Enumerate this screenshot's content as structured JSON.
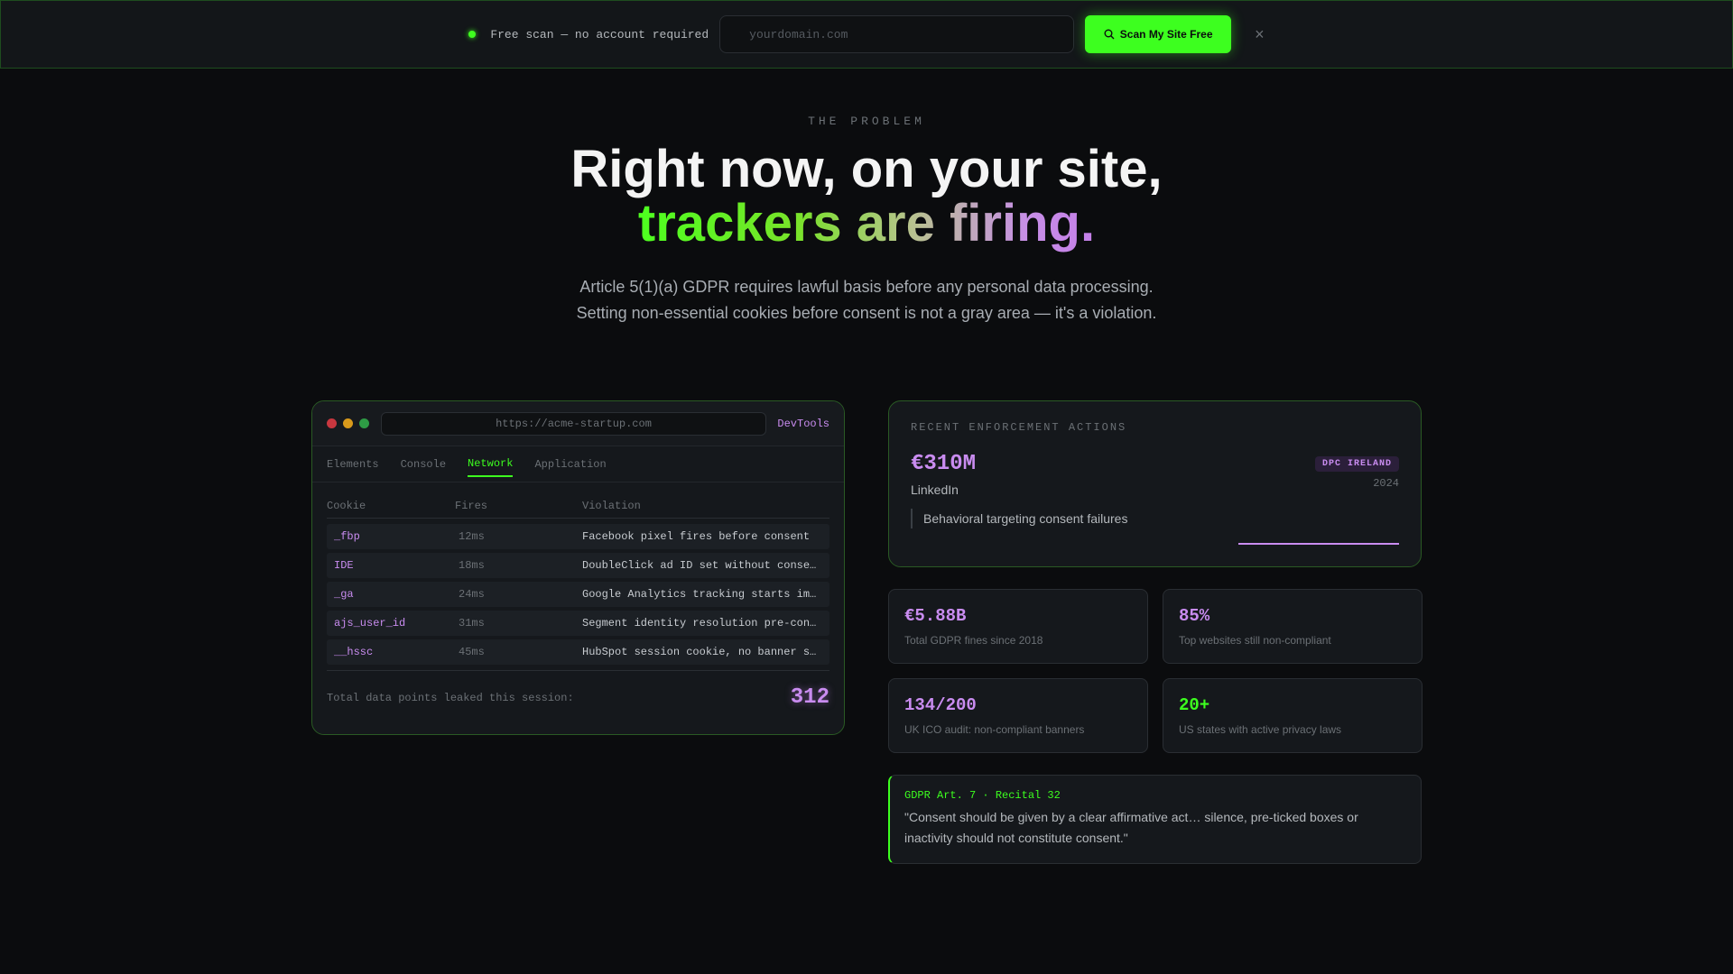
{
  "topbar": {
    "status_text": "Free scan — no account required",
    "input_placeholder": "yourdomain.com",
    "scan_button_label": "Scan My Site Free",
    "close_glyph": "×",
    "accent_color": "#3dff1f"
  },
  "hero": {
    "eyebrow": "THE PROBLEM",
    "title_line1": "Right now, on your site,",
    "title_line2": "trackers are firing.",
    "subtitle_line1": "Article 5(1)(a) GDPR requires lawful basis before any personal data processing.",
    "subtitle_line2": "Setting non-essential cookies before consent is not a gray area — it's a violation."
  },
  "devtools": {
    "url": "https://acme-startup.com",
    "label": "DevTools",
    "tabs": [
      "Elements",
      "Console",
      "Network",
      "Application"
    ],
    "active_tab": "Network",
    "columns": [
      "Cookie",
      "Fires",
      "Violation"
    ],
    "rows": [
      {
        "cookie": "_fbp",
        "fires": "12ms",
        "violation": "Facebook pixel fires before consent"
      },
      {
        "cookie": "IDE",
        "fires": "18ms",
        "violation": "DoubleClick ad ID set without consent"
      },
      {
        "cookie": "_ga",
        "fires": "24ms",
        "violation": "Google Analytics tracking starts immediately"
      },
      {
        "cookie": "ajs_user_id",
        "fires": "31ms",
        "violation": "Segment identity resolution pre-consent"
      },
      {
        "cookie": "__hssc",
        "fires": "45ms",
        "violation": "HubSpot session cookie, no banner shown"
      }
    ],
    "footer_label": "Total data points leaked this session:",
    "footer_count": "312",
    "traffic_light_colors": [
      "#c8373f",
      "#d99a1b",
      "#2e9b45"
    ]
  },
  "enforcement": {
    "eyebrow": "RECENT ENFORCEMENT ACTIONS",
    "amount": "€310M",
    "company": "LinkedIn",
    "badge": "DPC IRELAND",
    "year": "2024",
    "reason": "Behavioral targeting consent failures"
  },
  "stats": [
    {
      "value": "€5.88B",
      "label": "Total GDPR fines since 2018"
    },
    {
      "value": "85%",
      "label": "Top websites still non-compliant"
    },
    {
      "value": "134/200",
      "label": "UK ICO audit: non-compliant banners"
    },
    {
      "value": "20+",
      "label": "US states with active privacy laws"
    }
  ],
  "quote": {
    "reference": "GDPR Art. 7 · Recital 32",
    "text": "\"Consent should be given by a clear affirmative act… silence, pre-ticked boxes or inactivity should not constitute consent.\""
  }
}
